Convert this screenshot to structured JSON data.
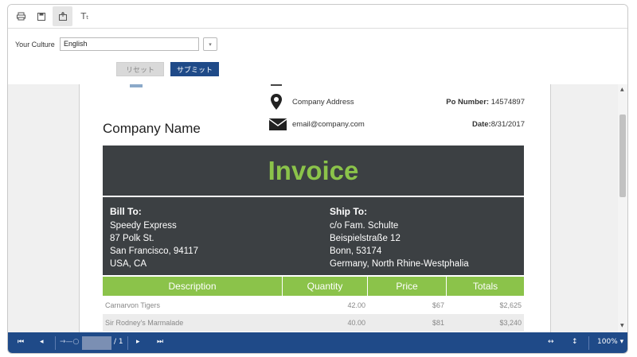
{
  "toolbar": {
    "buttons": [
      {
        "name": "print-icon",
        "glyph": "⎙"
      },
      {
        "name": "save-icon",
        "glyph": "▣"
      },
      {
        "name": "export-icon",
        "glyph": "⇪"
      },
      {
        "name": "text-format-icon",
        "glyph": "Tₜ"
      }
    ]
  },
  "params": {
    "culture_label": "Your Culture",
    "culture_value": "English",
    "reset_label": "リセット",
    "submit_label": "サブミット"
  },
  "invoice": {
    "company_name": "Company Name",
    "company_address": "Company Address",
    "email": "email@company.com",
    "po_label": "Po Number:",
    "po_value": "14574897",
    "date_label": "Date:",
    "date_value": "8/31/2017",
    "title": "Invoice",
    "bill_to_label": "Bill To:",
    "bill_to": [
      "Speedy Express",
      "87 Polk St.",
      "San Francisco, 94117",
      "USA, CA"
    ],
    "ship_to_label": "Ship To:",
    "ship_to": [
      "c/o Fam. Schulte",
      "Beispielstraße 12",
      "Bonn, 53174",
      "Germany, North Rhine-Westphalia"
    ],
    "columns": [
      "Description",
      "Quantity",
      "Price",
      "Totals"
    ],
    "rows": [
      {
        "description": "Carnarvon Tigers",
        "quantity": "42.00",
        "price": "$67",
        "total": "$2,625"
      },
      {
        "description": "Sir Rodney's Marmalade",
        "quantity": "40.00",
        "price": "$81",
        "total": "$3,240"
      }
    ]
  },
  "bottombar": {
    "page_range": "→—○",
    "page_of": "/ 1",
    "zoom": "100%"
  },
  "colors": {
    "accent_green": "#8bc34a",
    "dark_band": "#3c4043",
    "brand_blue": "#1f4a88"
  }
}
